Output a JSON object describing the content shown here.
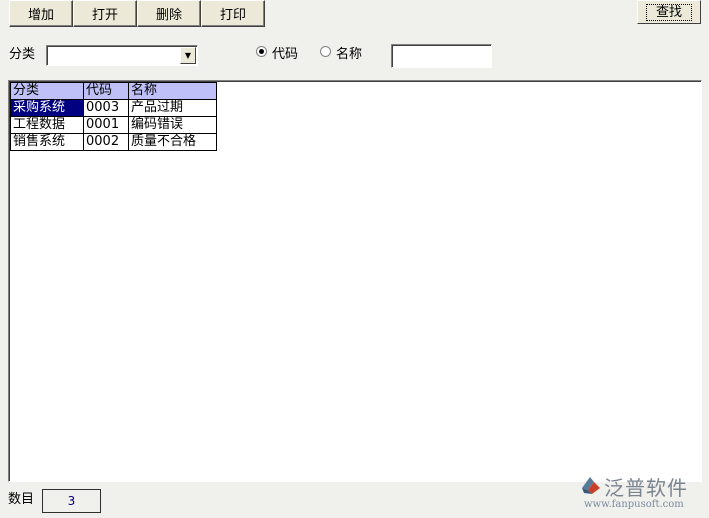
{
  "toolbar": {
    "add_label": "增加",
    "open_label": "打开",
    "delete_label": "删除",
    "print_label": "打印",
    "find_label": "查找"
  },
  "filter": {
    "category_label": "分类",
    "category_value": "",
    "radio_code_label": "代码",
    "radio_name_label": "名称",
    "radio_selected": "代码",
    "search_value": ""
  },
  "grid": {
    "columns": [
      "分类",
      "代码",
      "名称"
    ],
    "rows": [
      {
        "category": "采购系统",
        "code": "0003",
        "name": "产品过期",
        "selected": true
      },
      {
        "category": "工程数据",
        "code": "0001",
        "name": "编码错误",
        "selected": false
      },
      {
        "category": "销售系统",
        "code": "0002",
        "name": "质量不合格",
        "selected": false
      }
    ]
  },
  "footer": {
    "count_label": "数目",
    "count_value": "3"
  },
  "watermark": {
    "brand_cn": "泛普软件",
    "url": "www.fanpusoft.com"
  },
  "colors": {
    "header_bg": "#c0c0f8",
    "selected_bg": "#000080",
    "window_bg": "#f0f0ec"
  }
}
